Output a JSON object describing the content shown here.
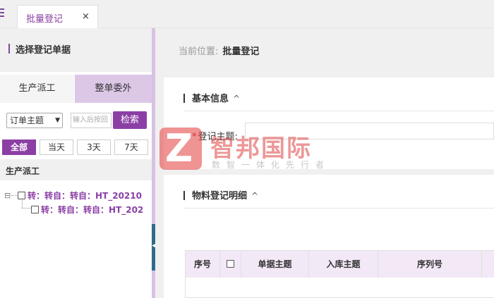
{
  "tabbar": {
    "tab_label": "批量登记",
    "close_glyph": "×"
  },
  "left": {
    "header_title": "选择登记单据",
    "tabs": [
      {
        "label": "生产派工"
      },
      {
        "label": "整单委外"
      }
    ],
    "filter": {
      "select_value": "订单主题",
      "keyword_placeholder": "输入后按回",
      "search_label": "检索"
    },
    "quick_ranges": [
      {
        "label": "全部",
        "active": true
      },
      {
        "label": "当天",
        "active": false
      },
      {
        "label": "3天",
        "active": false
      },
      {
        "label": "7天",
        "active": false
      }
    ],
    "tree_header": "生产派工",
    "tree_nodes": [
      {
        "label": "转：转自：转自：HT_20210"
      },
      {
        "label": "转：转自：转自：HT_202"
      }
    ]
  },
  "right": {
    "breadcrumb_prefix": "当前位置:",
    "breadcrumb_current": "批量登记",
    "basic_section": {
      "title": "基本信息",
      "chevron": "^",
      "field_label": "登记主题:",
      "required_mark": "*"
    },
    "detail_section": {
      "title": "物料登记明细",
      "chevron": "^",
      "columns": [
        "序号",
        "",
        "单据主题",
        "入库主题",
        "序列号"
      ]
    }
  },
  "watermark": {
    "logo_letter": "Z",
    "name": "智邦国际",
    "slogan": "数智一体化先行者"
  },
  "colors": {
    "accent": "#8b3fa5",
    "accent_light": "#dcc7e7",
    "table_header": "#f2e8f6",
    "splitter_grip": "#33698a",
    "logo_red": "#e33b3b"
  }
}
